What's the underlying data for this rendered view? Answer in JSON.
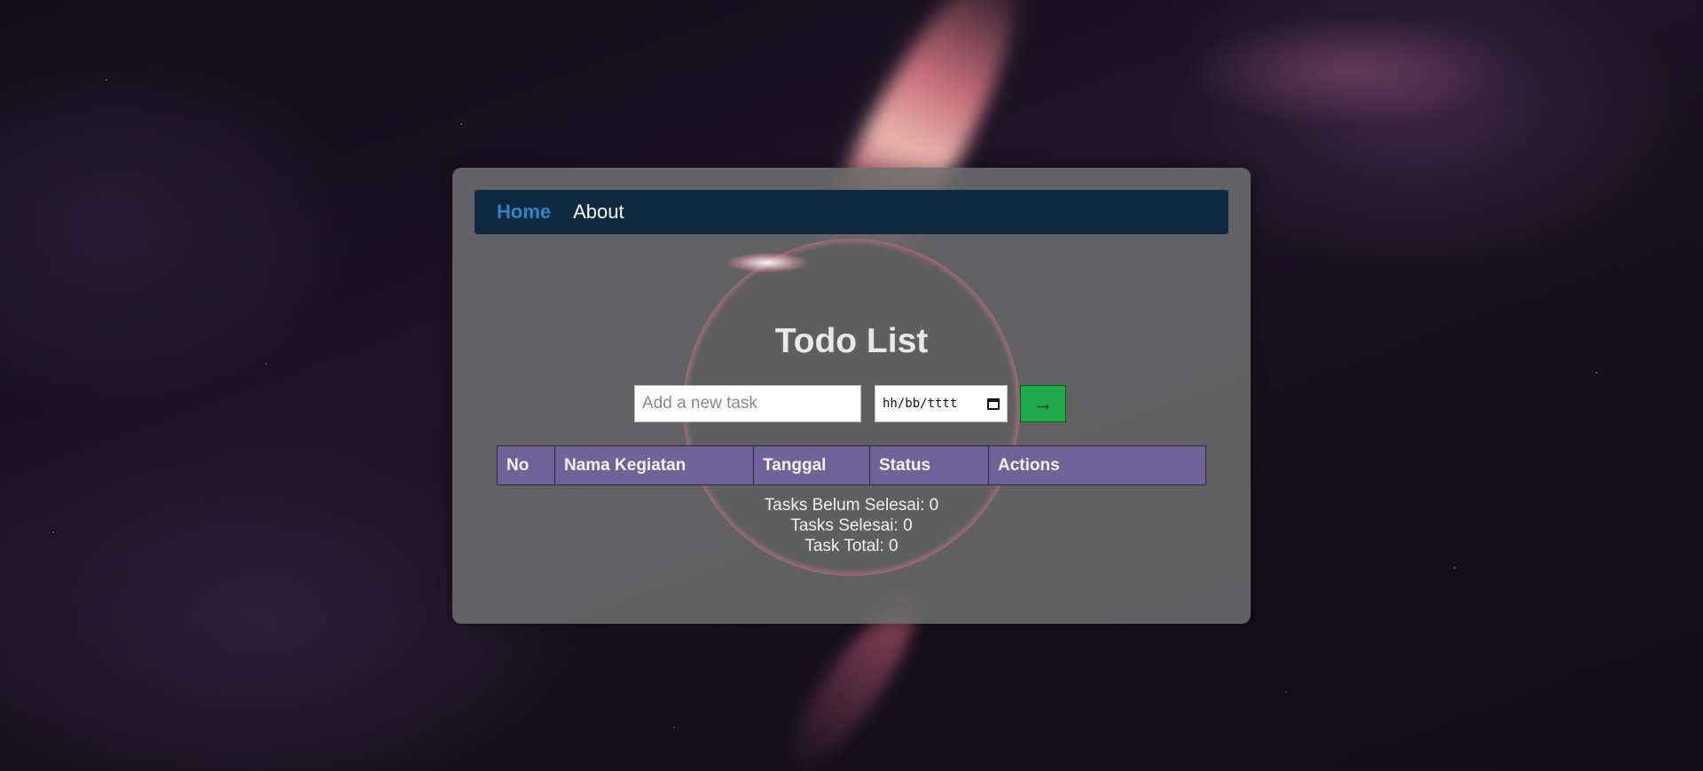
{
  "nav": {
    "items": [
      {
        "label": "Home",
        "active": true
      },
      {
        "label": "About",
        "active": false
      }
    ],
    "active_color": "#2d85c8",
    "background": "#0f2a40"
  },
  "page": {
    "title": "Todo List"
  },
  "form": {
    "task_placeholder": "Add a new task",
    "task_value": "",
    "date_placeholder": "hh/bb/tttt",
    "submit_icon": "arrow-right-icon",
    "submit_glyph": "→",
    "submit_color": "#1fa84a"
  },
  "table": {
    "columns": [
      "No",
      "Nama Kegiatan",
      "Tanggal",
      "Status",
      "Actions"
    ],
    "rows": [],
    "header_color": "#6f6399"
  },
  "stats": {
    "belum_selesai": "Tasks Belum Selesai: 0",
    "selesai": "Tasks Selesai: 0",
    "total": "Task Total: 0"
  }
}
